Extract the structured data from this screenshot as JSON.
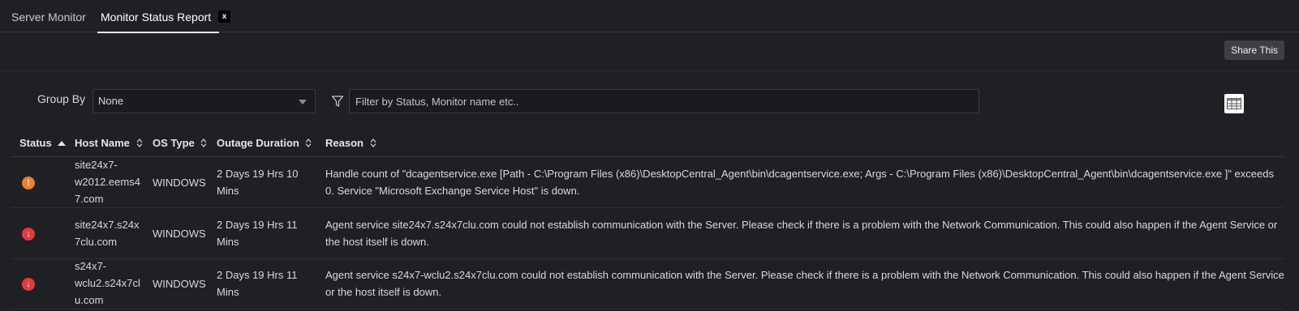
{
  "tabs": [
    {
      "label": "Server Monitor",
      "active": false
    },
    {
      "label": "Monitor Status Report",
      "active": true,
      "close_label": "x"
    }
  ],
  "toolbar": {
    "share_label": "Share This"
  },
  "filters": {
    "group_by_label": "Group By",
    "group_by_value": "None",
    "filter_placeholder": "Filter by Status, Monitor name etc.."
  },
  "table": {
    "columns": [
      "Status",
      "Host Name",
      "OS Type",
      "Outage Duration",
      "Reason"
    ],
    "rows": [
      {
        "status": "trouble",
        "host": [
          "site24x7-",
          "w2012.eems4",
          "7.com"
        ],
        "os": "WINDOWS",
        "duration": [
          "2 Days 19 Hrs 10",
          "Mins"
        ],
        "reason": [
          "Handle count of \"dcagentservice.exe [Path - C:\\Program Files (x86)\\DesktopCentral_Agent\\bin\\dcagentservice.exe; Args - C:\\Program Files (x86)\\DesktopCentral_Agent\\bin\\dcagentservice.exe ]\" exceeds",
          "0. Service \"Microsoft Exchange Service Host\" is down."
        ]
      },
      {
        "status": "down",
        "host": [
          "site24x7.s24x",
          "7clu.com"
        ],
        "os": "WINDOWS",
        "duration": [
          "2 Days 19 Hrs 11",
          "Mins"
        ],
        "reason": [
          "Agent service site24x7.s24x7clu.com could not establish communication with the Server. Please check if there is a problem with the Network Communication. This could also happen if the Agent Service or",
          "the host itself is down."
        ]
      },
      {
        "status": "down",
        "host": [
          "s24x7-",
          "wclu2.s24x7cl",
          "u.com"
        ],
        "os": "WINDOWS",
        "duration": [
          "2 Days 19 Hrs 11",
          "Mins"
        ],
        "reason": [
          "Agent service s24x7-wclu2.s24x7clu.com could not establish communication with the Server. Please check if there is a problem with the Network Communication. This could also happen if the Agent Service",
          "or the host itself is down."
        ]
      }
    ]
  },
  "colors": {
    "background": "#1f2023",
    "trouble": "#f07f2e",
    "down": "#e23b3b"
  }
}
